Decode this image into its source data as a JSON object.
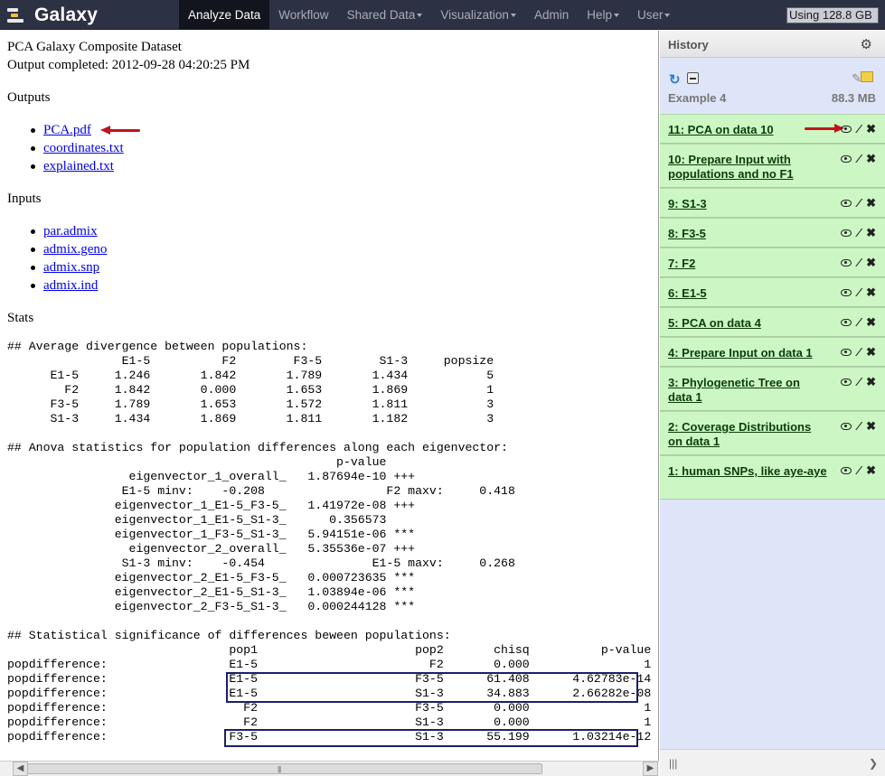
{
  "masthead": {
    "brand": "Galaxy",
    "tabs": [
      {
        "label": "Analyze Data",
        "active": true,
        "menu": false
      },
      {
        "label": "Workflow",
        "active": false,
        "menu": false
      },
      {
        "label": "Shared Data",
        "active": false,
        "menu": true
      },
      {
        "label": "Visualization",
        "active": false,
        "menu": true
      },
      {
        "label": "Admin",
        "active": false,
        "menu": false
      },
      {
        "label": "Help",
        "active": false,
        "menu": true
      },
      {
        "label": "User",
        "active": false,
        "menu": true
      }
    ],
    "quota_label": "Using 128.8 GB",
    "quota_fill_percent": 100
  },
  "center": {
    "title": "PCA Galaxy Composite Dataset",
    "output_line": "Output completed: 2012-09-28 04:20:25 PM",
    "outputs_heading": "Outputs",
    "outputs": [
      "PCA.pdf",
      "coordinates.txt",
      "explained.txt"
    ],
    "inputs_heading": "Inputs",
    "inputs": [
      "par.admix",
      "admix.geno",
      "admix.snp",
      "admix.ind"
    ],
    "stats_heading": "Stats",
    "stats_text": "## Average divergence between populations:\n                E1-5          F2        F3-5        S1-3     popsize\n      E1-5     1.246       1.842       1.789       1.434           5\n        F2     1.842       0.000       1.653       1.869           1\n      F3-5     1.789       1.653       1.572       1.811           3\n      S1-3     1.434       1.869       1.811       1.182           3\n\n## Anova statistics for population differences along each eigenvector:\n                                              p-value\n                 eigenvector_1_overall_   1.87694e-10 +++\n                E1-5 minv:    -0.208                 F2 maxv:     0.418\n               eigenvector_1_E1-5_F3-5_   1.41972e-08 +++\n               eigenvector_1_E1-5_S1-3_      0.356573\n               eigenvector_1_F3-5_S1-3_   5.94151e-06 ***\n                 eigenvector_2_overall_   5.35536e-07 +++\n                S1-3 minv:    -0.454               E1-5 maxv:     0.268\n               eigenvector_2_E1-5_F3-5_   0.000723635 ***\n               eigenvector_2_E1-5_S1-3_   1.03894e-06 ***\n               eigenvector_2_F3-5_S1-3_   0.000244128 ***\n\n## Statistical significance of differences beween populations:\n                               pop1                      pop2       chisq          p-value   |\npopdifference:                 E1-5                        F2       0.000                1\npopdifference:                 E1-5                      F3-5      61.408      4.62783e-14\npopdifference:                 E1-5                      S1-3      34.883      2.66282e-08\npopdifference:                   F2                      F3-5       0.000                1\npopdifference:                   F2                      S1-3       0.000                1\npopdifference:                 F3-5                      S1-3      55.199      1.03214e-12"
  },
  "history": {
    "panel_title": "History",
    "name": "Example 4",
    "size": "88.3 MB",
    "datasets": [
      {
        "label": "11: PCA on data 10",
        "highlighted": true
      },
      {
        "label": "10: Prepare Input with populations and no F1",
        "highlighted": false
      },
      {
        "label": "9: S1-3",
        "highlighted": false
      },
      {
        "label": "8: F3-5",
        "highlighted": false
      },
      {
        "label": "7: F2",
        "highlighted": false
      },
      {
        "label": "6: E1-5",
        "highlighted": false
      },
      {
        "label": "5: PCA on data 4",
        "highlighted": false
      },
      {
        "label": "4: Prepare Input on data 1",
        "highlighted": false
      },
      {
        "label": "3: Phylogenetic Tree on data 1",
        "highlighted": false
      },
      {
        "label": "2: Coverage Distributions on data 1",
        "highlighted": false
      },
      {
        "label": "1: human SNPs, like aye-aye",
        "highlighted": false
      }
    ]
  },
  "colors": {
    "masthead_bg": "#2c3143",
    "history_bg": "#dfe5f9",
    "dataset_ok_bg": "#ccf7c4",
    "annotation_arrow": "#c0141a",
    "highlight_box": "#1b2067"
  }
}
